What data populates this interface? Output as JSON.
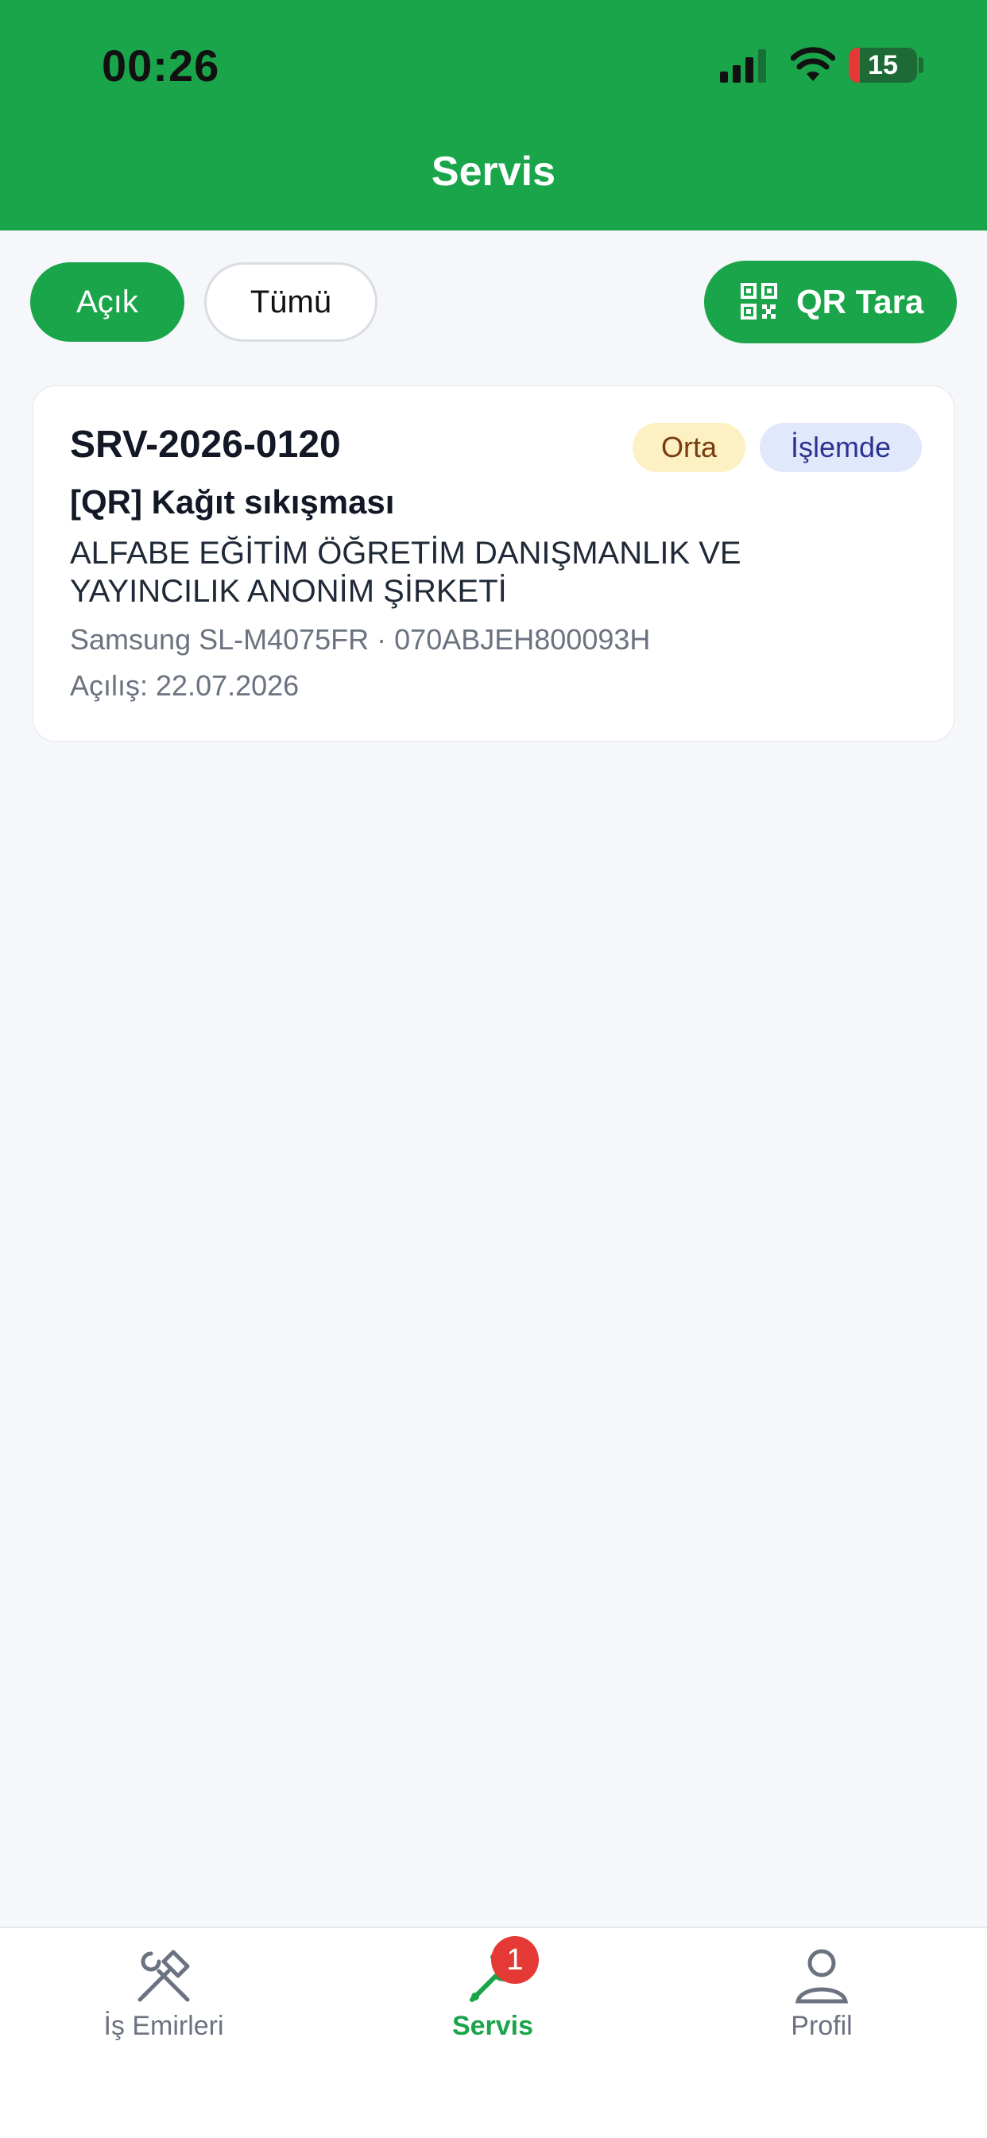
{
  "status_bar": {
    "time": "00:26",
    "battery_level": "15",
    "icons": [
      "cellular-signal-icon",
      "wifi-icon",
      "battery-icon"
    ]
  },
  "header": {
    "title": "Servis"
  },
  "filters": {
    "open_label": "Açık",
    "all_label": "Tümü",
    "selected": "Açık",
    "qr_label": "QR Tara",
    "qr_icon": "qr-code-icon"
  },
  "tickets": [
    {
      "id": "SRV-2026-0120",
      "priority": "Orta",
      "status": "İşlemde",
      "title": "[QR] Kağıt sıkışması",
      "company": "ALFABE EĞİTİM ÖĞRETİM DANIŞMANLIK VE YAYINCILIK ANONİM ŞİRKETİ",
      "device": "Samsung SL-M4075FR · 070ABJEH800093H",
      "opened": "Açılış: 22.07.2026"
    }
  ],
  "bottom_nav": {
    "items": [
      {
        "label": "İş Emirleri",
        "icon": "tools-icon"
      },
      {
        "label": "Servis",
        "icon": "wrench-icon",
        "badge": "1",
        "active": true
      },
      {
        "label": "Profil",
        "icon": "person-icon"
      }
    ]
  },
  "colors": {
    "brand_green": "#1ba54a",
    "badge_red": "#e53935",
    "priority_bg": "#fdf0c2",
    "status_bg": "#e2e8fb"
  }
}
